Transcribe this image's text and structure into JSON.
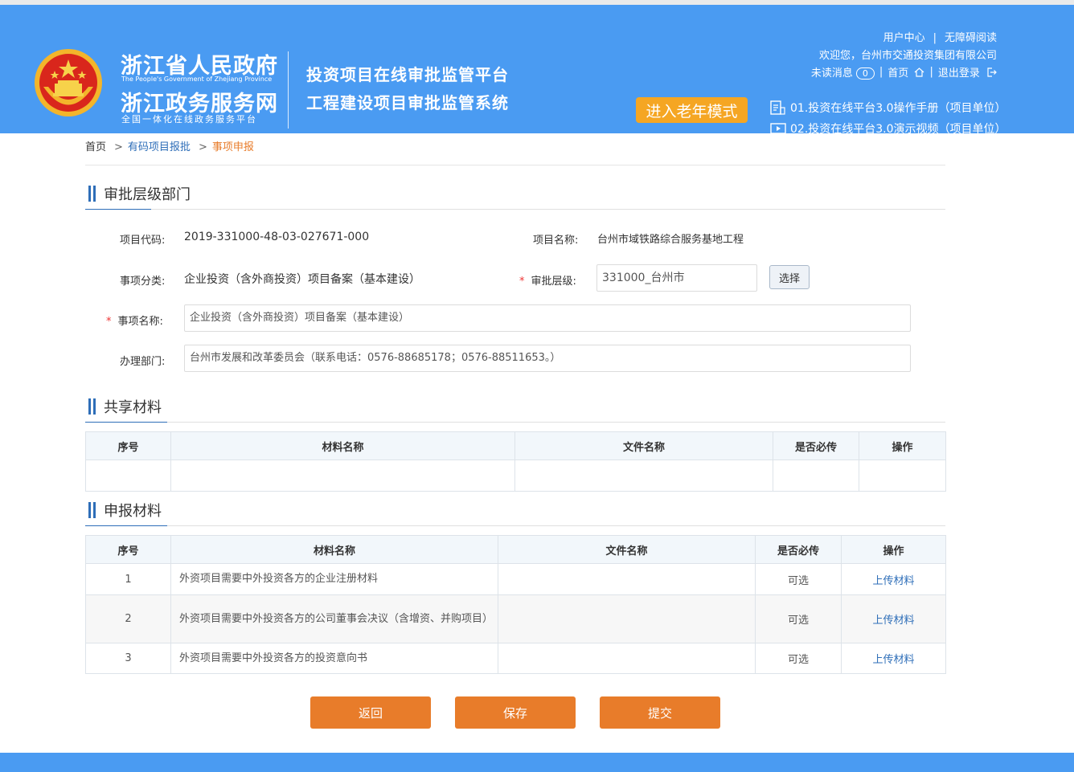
{
  "header": {
    "gov_title": "浙江省人民政府",
    "gov_en": "The People's Government of Zhejiang Province",
    "service_title": "浙江政务服务网",
    "service_sub": "全国一体化在线政务服务平台",
    "platform_line1": "投资项目在线审批监管平台",
    "platform_line2": "工程建设项目审批监管系统",
    "elder_mode": "进入老年模式",
    "user_center": "用户中心",
    "accessible": "无障碍阅读",
    "welcome": "欢迎您，台州市交通投资集团有限公司",
    "unread_label": "未读消息",
    "unread_count": "0",
    "home": "首页",
    "logout": "退出登录",
    "doc1": "01.投资在线平台3.0操作手册（项目单位）",
    "doc2": "02.投资在线平台3.0演示视频（项目单位）",
    "brand_color": "#4a9bf2",
    "accent_color": "#f5a623"
  },
  "breadcrumb": {
    "home": "首页",
    "arrow": ">",
    "level2": "有码项目报批",
    "current": "事项申报"
  },
  "section_dept": {
    "title": "审批层级部门",
    "project_code_label": "项目代码:",
    "project_code": "2019-331000-48-03-027671-000",
    "project_name_label": "项目名称:",
    "project_name": "台州市域铁路综合服务基地工程",
    "category_label": "事项分类:",
    "category": "企业投资（含外商投资）项目备案（基本建设）",
    "level_label": "审批层级:",
    "level_value": "331000_台州市",
    "select_button": "选择",
    "item_name_label": "事项名称:",
    "item_name": "企业投资（含外商投资）项目备案（基本建设）",
    "dept_label": "办理部门:",
    "dept_value": "台州市发展和改革委员会（联系电话：0576-88685178；0576-88511653。）",
    "required_mark": "*"
  },
  "section_shared": {
    "title": "共享材料",
    "columns": [
      "序号",
      "材料名称",
      "文件名称",
      "是否必传",
      "操作"
    ]
  },
  "section_report": {
    "title": "申报材料",
    "columns": [
      "序号",
      "材料名称",
      "文件名称",
      "是否必传",
      "操作"
    ],
    "rows": [
      {
        "no": "1",
        "name": "外资项目需要中外投资各方的企业注册材料",
        "file": "",
        "required": "可选",
        "action": "上传材料"
      },
      {
        "no": "2",
        "name": "外资项目需要中外投资各方的公司董事会决议（含增资、并购项目）",
        "file": "",
        "required": "可选",
        "action": "上传材料"
      },
      {
        "no": "3",
        "name": "外资项目需要中外投资各方的投资意向书",
        "file": "",
        "required": "可选",
        "action": "上传材料"
      }
    ]
  },
  "actions": {
    "back": "返回",
    "save": "保存",
    "submit": "提交",
    "button_color": "#e87c2a"
  }
}
